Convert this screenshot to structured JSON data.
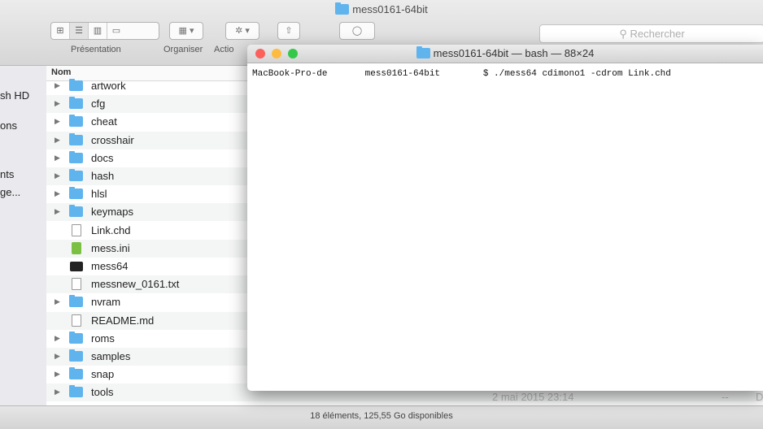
{
  "finder": {
    "title": "mess0161-64bit",
    "toolbar": {
      "presentation_label": "Présentation",
      "organiser_label": "Organiser",
      "action_label": "Actio",
      "search_placeholder": "Rechercher"
    },
    "sidebar": {
      "items": [
        "sh HD",
        "ons",
        "nts",
        "ge..."
      ]
    },
    "list": {
      "column_name": "Nom",
      "rows": [
        {
          "name": "artwork",
          "type": "folder"
        },
        {
          "name": "cfg",
          "type": "folder"
        },
        {
          "name": "cheat",
          "type": "folder"
        },
        {
          "name": "crosshair",
          "type": "folder"
        },
        {
          "name": "docs",
          "type": "folder"
        },
        {
          "name": "hash",
          "type": "folder"
        },
        {
          "name": "hlsl",
          "type": "folder"
        },
        {
          "name": "keymaps",
          "type": "folder"
        },
        {
          "name": "Link.chd",
          "type": "doc"
        },
        {
          "name": "mess.ini",
          "type": "ini"
        },
        {
          "name": "mess64",
          "type": "exec"
        },
        {
          "name": "messnew_0161.txt",
          "type": "doc"
        },
        {
          "name": "nvram",
          "type": "folder"
        },
        {
          "name": "README.md",
          "type": "doc"
        },
        {
          "name": "roms",
          "type": "folder"
        },
        {
          "name": "samples",
          "type": "folder"
        },
        {
          "name": "snap",
          "type": "folder"
        },
        {
          "name": "tools",
          "type": "folder"
        }
      ],
      "tools_date": "2 mai 2015 23:14",
      "tools_size": "--",
      "tools_kind": "D"
    },
    "status": "18 éléments, 125,55 Go disponibles"
  },
  "terminal": {
    "title": "mess0161-64bit — bash — 88×24",
    "line": "MacBook-Pro-de       mess0161-64bit        $ ./mess64 cdimono1 -cdrom Link.chd"
  },
  "colors": {
    "close": "#fc605c",
    "minimize": "#fdbc40",
    "zoom": "#34c84a",
    "folder": "#5fb4ee"
  }
}
